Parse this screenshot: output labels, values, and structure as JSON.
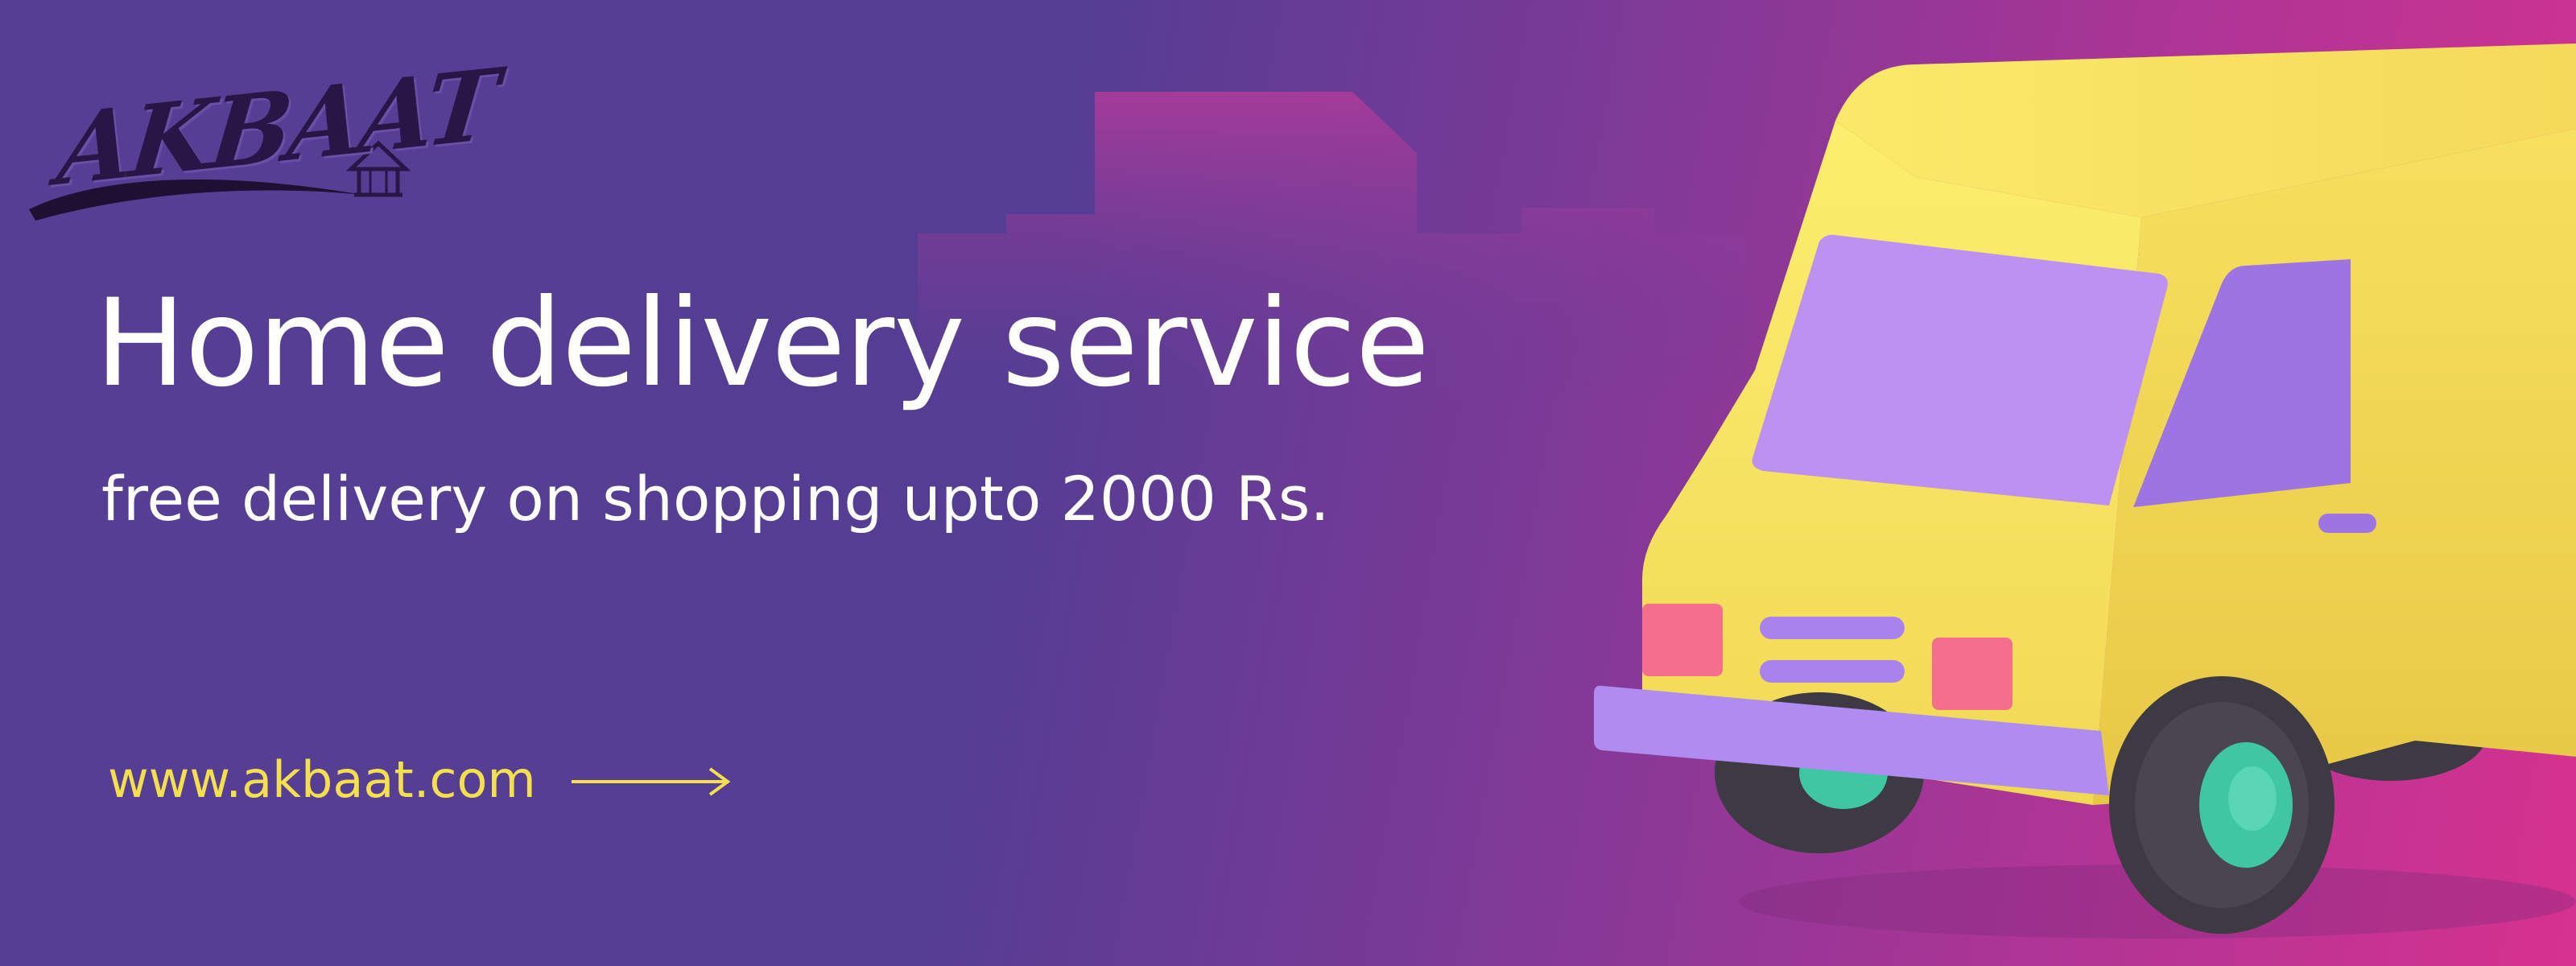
{
  "brand": {
    "logo_text": "AKBAAT"
  },
  "hero": {
    "headline": "Home delivery service",
    "subheadline": "free delivery on shopping upto 2000 Rs."
  },
  "cta": {
    "website": "www.akbaat.com"
  },
  "colors": {
    "background_start": "#563e95",
    "background_end": "#d7328f",
    "text": "#ffffff",
    "accent": "#f4e04d",
    "van_body": "#f7e360",
    "van_window": "#b991f0",
    "van_wheel_hub": "#3fc7a3"
  },
  "icons": {
    "arrow": "arrow-right-icon",
    "van": "delivery-van-illustration"
  }
}
